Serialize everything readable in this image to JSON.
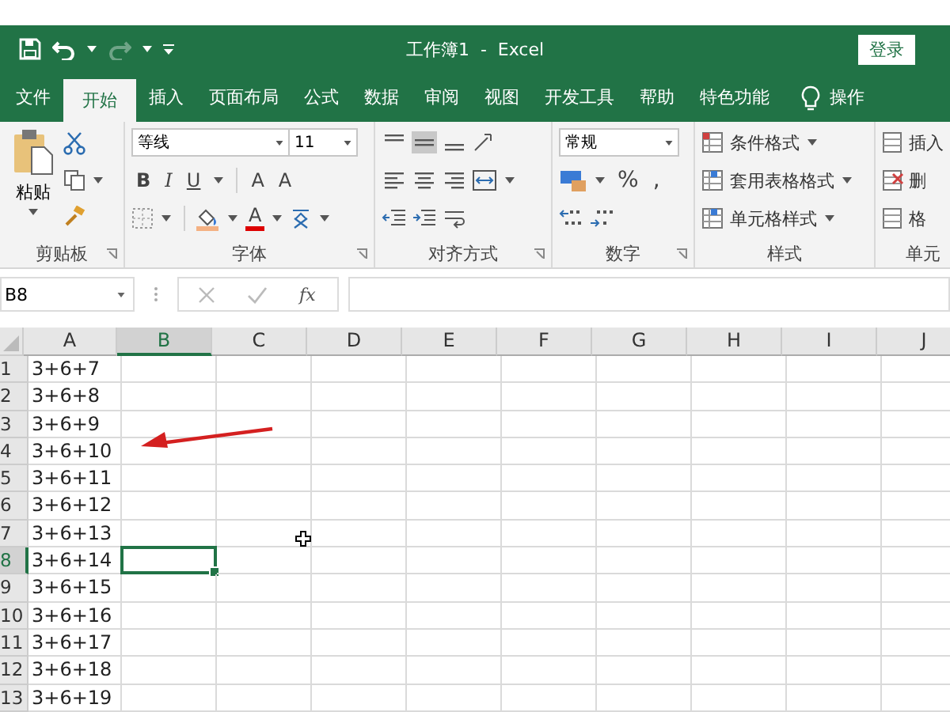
{
  "quick_access": {
    "undo_enabled": true,
    "redo_enabled": false
  },
  "window": {
    "title": "工作簿1  -  Excel",
    "login_button": "登录"
  },
  "tabs": [
    {
      "label": "文件",
      "selected": false
    },
    {
      "label": "开始",
      "selected": true
    },
    {
      "label": "插入",
      "selected": false
    },
    {
      "label": "页面布局",
      "selected": false
    },
    {
      "label": "公式",
      "selected": false
    },
    {
      "label": "数据",
      "selected": false
    },
    {
      "label": "审阅",
      "selected": false
    },
    {
      "label": "视图",
      "selected": false
    },
    {
      "label": "开发工具",
      "selected": false
    },
    {
      "label": "帮助",
      "selected": false
    },
    {
      "label": "特色功能",
      "selected": false
    }
  ],
  "tell_me": "操作",
  "ribbon": {
    "clipboard": {
      "paste": "粘贴",
      "label": "剪贴板"
    },
    "font": {
      "name": "等线",
      "size": "11",
      "bold": "B",
      "italic": "I",
      "underline": "U",
      "grow": "A",
      "shrink": "A",
      "color_letter": "A",
      "label": "字体"
    },
    "alignment": {
      "label": "对齐方式"
    },
    "number": {
      "format": "常规",
      "percent": "%",
      "comma": ",",
      "label": "数字"
    },
    "styles": {
      "items": [
        "条件格式",
        "套用表格格式",
        "单元格样式"
      ],
      "label": "样式"
    },
    "cells": {
      "items": [
        "插入",
        "删",
        "格"
      ],
      "label": "单元"
    }
  },
  "formula_bar": {
    "name_box": "B8",
    "fx": "fx"
  },
  "columns": [
    {
      "label": "A",
      "selected": false
    },
    {
      "label": "B",
      "selected": true
    },
    {
      "label": "C",
      "selected": false
    },
    {
      "label": "D",
      "selected": false
    },
    {
      "label": "E",
      "selected": false
    },
    {
      "label": "F",
      "selected": false
    },
    {
      "label": "G",
      "selected": false
    },
    {
      "label": "H",
      "selected": false
    },
    {
      "label": "I",
      "selected": false
    },
    {
      "label": "J",
      "selected": false
    }
  ],
  "rows": [
    {
      "number": "1",
      "a": "3+6+7",
      "selected": false
    },
    {
      "number": "2",
      "a": "3+6+8",
      "selected": false
    },
    {
      "number": "3",
      "a": "3+6+9",
      "selected": false
    },
    {
      "number": "4",
      "a": "3+6+10",
      "selected": false
    },
    {
      "number": "5",
      "a": "3+6+11",
      "selected": false
    },
    {
      "number": "6",
      "a": "3+6+12",
      "selected": false
    },
    {
      "number": "7",
      "a": "3+6+13",
      "selected": false
    },
    {
      "number": "8",
      "a": "3+6+14",
      "selected": true
    },
    {
      "number": "9",
      "a": "3+6+15",
      "selected": false
    },
    {
      "number": "10",
      "a": "3+6+16",
      "selected": false
    },
    {
      "number": "11",
      "a": "3+6+17",
      "selected": false
    },
    {
      "number": "12",
      "a": "3+6+18",
      "selected": false
    },
    {
      "number": "13",
      "a": "3+6+19",
      "selected": false
    }
  ]
}
